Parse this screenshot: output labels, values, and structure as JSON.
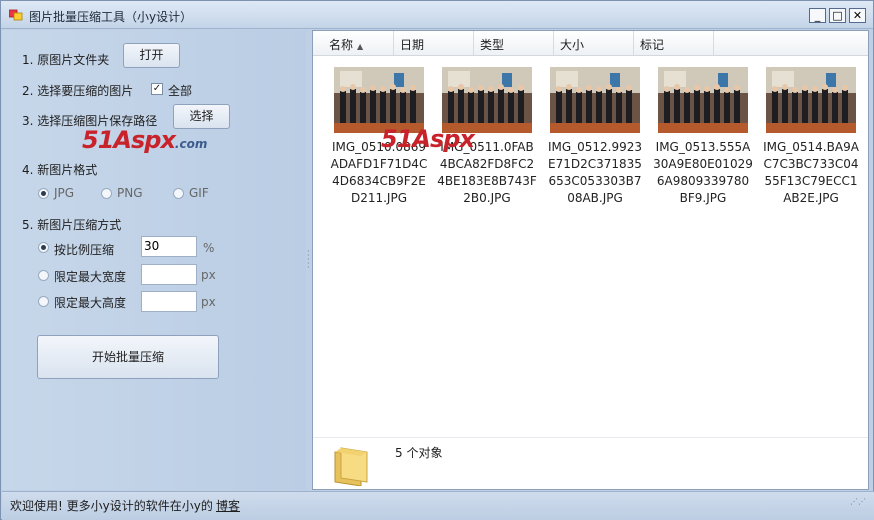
{
  "window": {
    "title": "图片批量压缩工具（小y设计）",
    "controls": {
      "minimize": "_",
      "maximize": "□",
      "close": "✕"
    }
  },
  "left": {
    "step1": {
      "label": "1. 原图片文件夹",
      "button": "打开"
    },
    "step2": {
      "label": "2. 选择要压缩的图片",
      "select_all_label": "全部",
      "select_all_checked": true
    },
    "step3": {
      "label": "3. 选择压缩图片保存路径",
      "button": "选择"
    },
    "step4": {
      "label": "4. 新图片格式",
      "options": [
        {
          "label": "JPG",
          "selected": true
        },
        {
          "label": "PNG",
          "selected": false
        },
        {
          "label": "GIF",
          "selected": false
        }
      ]
    },
    "step5": {
      "label": "5. 新图片压缩方式",
      "options": [
        {
          "label": "按比例压缩",
          "selected": true,
          "value": "30",
          "unit": "%"
        },
        {
          "label": "限定最大宽度",
          "selected": false,
          "value": "",
          "unit": "px"
        },
        {
          "label": "限定最大高度",
          "selected": false,
          "value": "",
          "unit": "px"
        }
      ]
    },
    "start_button": "开始批量压缩",
    "watermark": {
      "brand": "51Aspx",
      "suffix": ".com"
    }
  },
  "list": {
    "columns": [
      "名称",
      "日期",
      "类型",
      "大小",
      "标记"
    ],
    "sorted_column": "名称",
    "files": [
      "IMG_0510.0869ADAFD1F71D4C4D6834CB9F2ED211.JPG",
      "IMG_0511.0FAB4BCA82FD8FC24BE183E8B743F2B0.JPG",
      "IMG_0512.9923E71D2C371835653C053303B708AB.JPG",
      "IMG_0513.555A30A9E80E010296A9809339780BF9.JPG",
      "IMG_0514.BA9AC7C3BC733C0455F13C79ECC1AB2E.JPG"
    ],
    "object_count": "5 个对象"
  },
  "statusbar": {
    "text": "欢迎使用! 更多小y设计的软件在小y的",
    "link": "博客"
  }
}
